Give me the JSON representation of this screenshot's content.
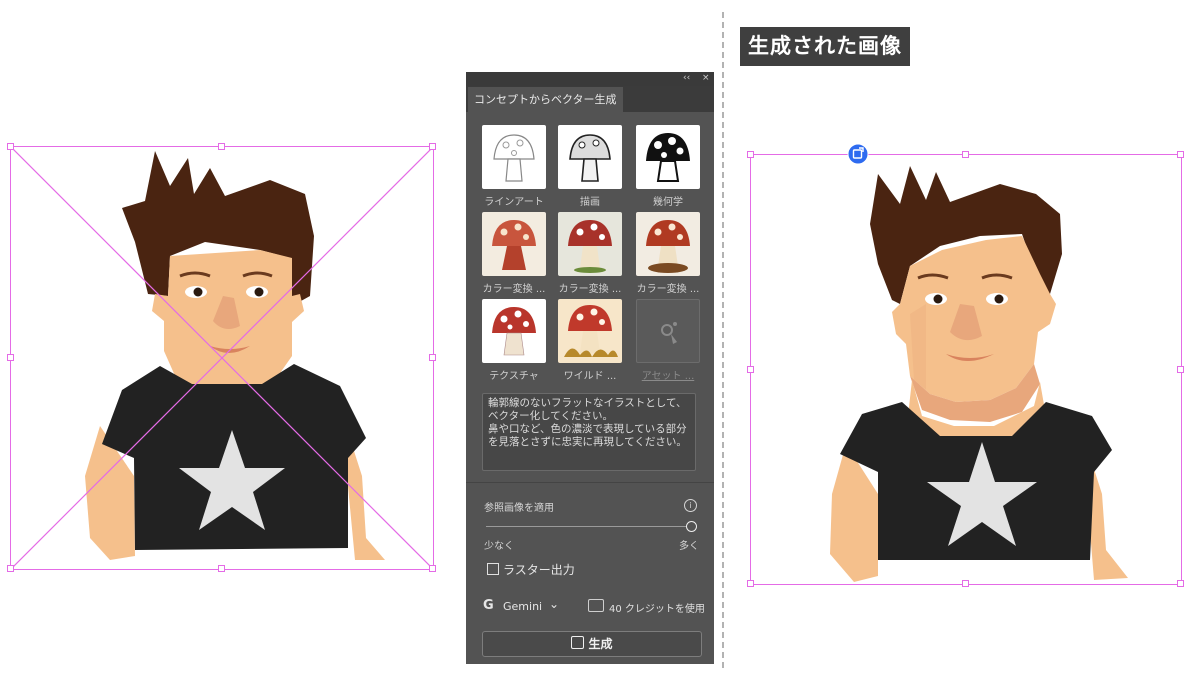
{
  "panel": {
    "collapse_glyph": "‹‹",
    "close_glyph": "×",
    "tab_label": "コンセプトからベクター生成",
    "styles": [
      {
        "label": "ラインアート",
        "icon": "mushroom-lineart-icon"
      },
      {
        "label": "描画",
        "icon": "mushroom-drawing-icon"
      },
      {
        "label": "幾何学",
        "icon": "mushroom-geometric-icon"
      },
      {
        "label": "カラー変換 ...",
        "icon": "mushroom-color-flat-icon"
      },
      {
        "label": "カラー変換 ...",
        "icon": "mushroom-color-shaded-icon"
      },
      {
        "label": "カラー変換 ...",
        "icon": "mushroom-color-painted-icon"
      },
      {
        "label": "テクスチャ",
        "icon": "mushroom-texture-icon"
      },
      {
        "label": "ワイルド ...",
        "icon": "mushroom-wild-icon"
      },
      {
        "label": "アセット ...",
        "icon": "asset-placeholder-icon"
      }
    ],
    "prompt": "輪郭線のないフラットなイラストとして、ベクター化してください。\n鼻や口など、色の濃淡で表現している部分を見落とさずに忠実に再現してください。",
    "reference_label": "参照画像を適用",
    "info_glyph": "i",
    "slider_min_label": "少なく",
    "slider_max_label": "多く",
    "slider_value": 1.0,
    "raster_output_label": "ラスター出力",
    "raster_output_checked": false,
    "model_glyph": "G",
    "model_label": "Gemini",
    "model_chevron": "⌄",
    "credit_label": "40 クレジットを使用",
    "generate_label": "生成"
  },
  "result_title": "生成された画像",
  "colors": {
    "panel_bg": "#535353",
    "selection": "#e46be6",
    "skin": "#f5c08c",
    "hair": "#4a2411",
    "shirt": "#222222",
    "star": "#e3e3e3"
  }
}
